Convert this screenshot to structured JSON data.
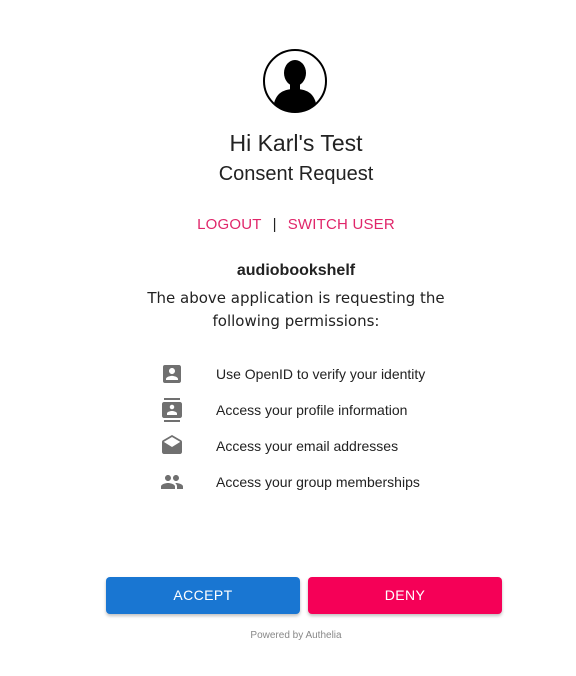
{
  "user": {
    "greeting": "Hi Karl's Test",
    "subtitle": "Consent Request"
  },
  "links": {
    "logout": "LOGOUT",
    "separator": "|",
    "switch_user": "SWITCH USER"
  },
  "request": {
    "client_name": "audiobookshelf",
    "message": "The above application is requesting the following permissions:"
  },
  "permissions": [
    {
      "icon": "account-box-icon",
      "label": "Use OpenID to verify your identity"
    },
    {
      "icon": "contacts-icon",
      "label": "Access your profile information"
    },
    {
      "icon": "drafts-icon",
      "label": "Access your email addresses"
    },
    {
      "icon": "group-icon",
      "label": "Access your group memberships"
    }
  ],
  "actions": {
    "accept_label": "ACCEPT",
    "deny_label": "DENY"
  },
  "footer": {
    "powered_by": "Powered by Authelia"
  },
  "colors": {
    "link": "#e0266a",
    "accept": "#1976d2",
    "deny": "#f50057"
  }
}
